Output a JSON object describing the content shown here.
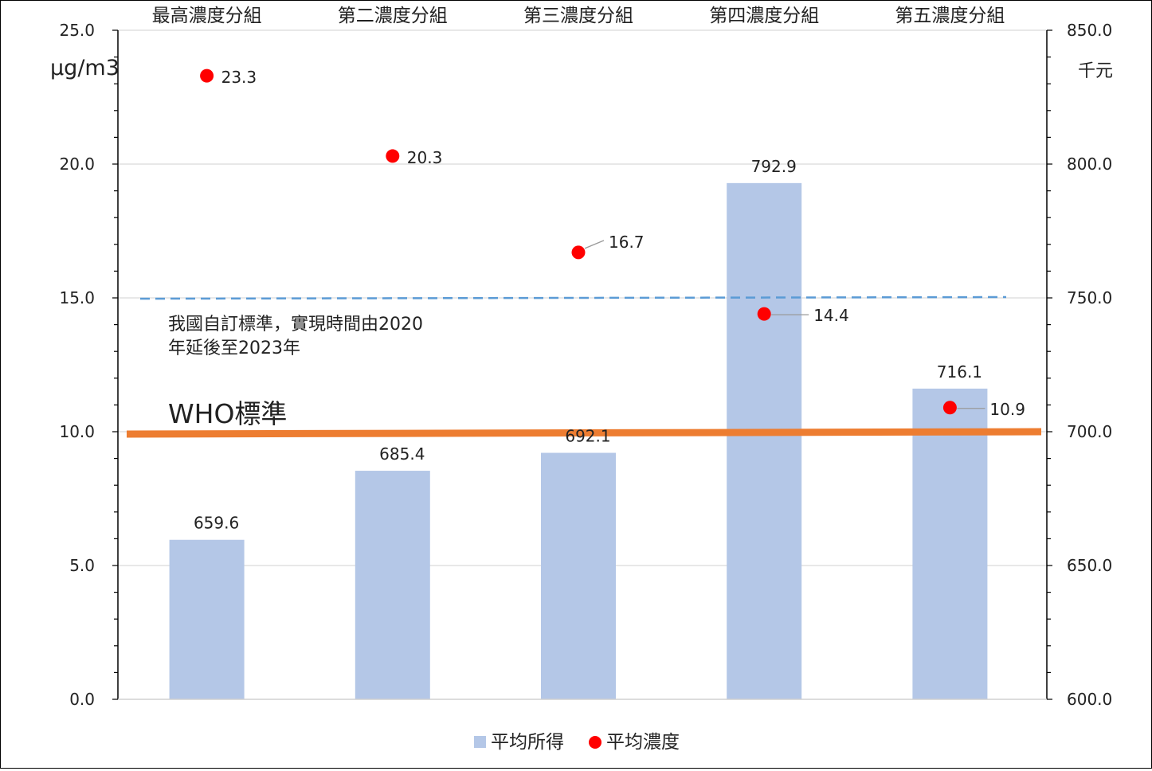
{
  "chart_data": {
    "type": "bar",
    "categories": [
      "最高濃度分組",
      "第二濃度分組",
      "第三濃度分組",
      "第四濃度分組",
      "第五濃度分組"
    ],
    "series": [
      {
        "name": "平均所得",
        "type": "bar",
        "axis": "right",
        "values": [
          659.6,
          685.4,
          692.1,
          792.9,
          716.1
        ],
        "color": "#b4c7e7"
      },
      {
        "name": "平均濃度",
        "type": "scatter",
        "axis": "left",
        "values": [
          23.3,
          20.3,
          16.7,
          14.4,
          10.9
        ],
        "color": "#ff0000"
      }
    ],
    "y_left": {
      "unit": "μg/m3",
      "min": 0,
      "max": 25,
      "major_step": 5,
      "minor_step": 1,
      "tick_labels": [
        "0.0",
        "5.0",
        "10.0",
        "15.0",
        "20.0",
        "25.0"
      ]
    },
    "y_right": {
      "unit": "千元",
      "min": 600,
      "max": 850,
      "major_step": 50,
      "minor_step": 10,
      "tick_labels": [
        "600.0",
        "650.0",
        "700.0",
        "750.0",
        "800.0",
        "850.0"
      ]
    },
    "reference_lines": [
      {
        "value": 15,
        "axis": "left",
        "style": "dashed",
        "color": "#5b9bd5",
        "annotation": [
          "我國自訂標準，實現時間由2020",
          "年延後至2023年"
        ]
      },
      {
        "value": 10,
        "axis": "left",
        "style": "solid",
        "color": "#ed7d31",
        "annotation": [
          "WHO標準"
        ]
      }
    ],
    "data_labels": {
      "bars": [
        "659.6",
        "685.4",
        "692.1",
        "792.9",
        "716.1"
      ],
      "points": [
        "23.3",
        "20.3",
        "16.7",
        "14.4",
        "10.9"
      ]
    },
    "grid": true,
    "legend": "bottom-center"
  }
}
